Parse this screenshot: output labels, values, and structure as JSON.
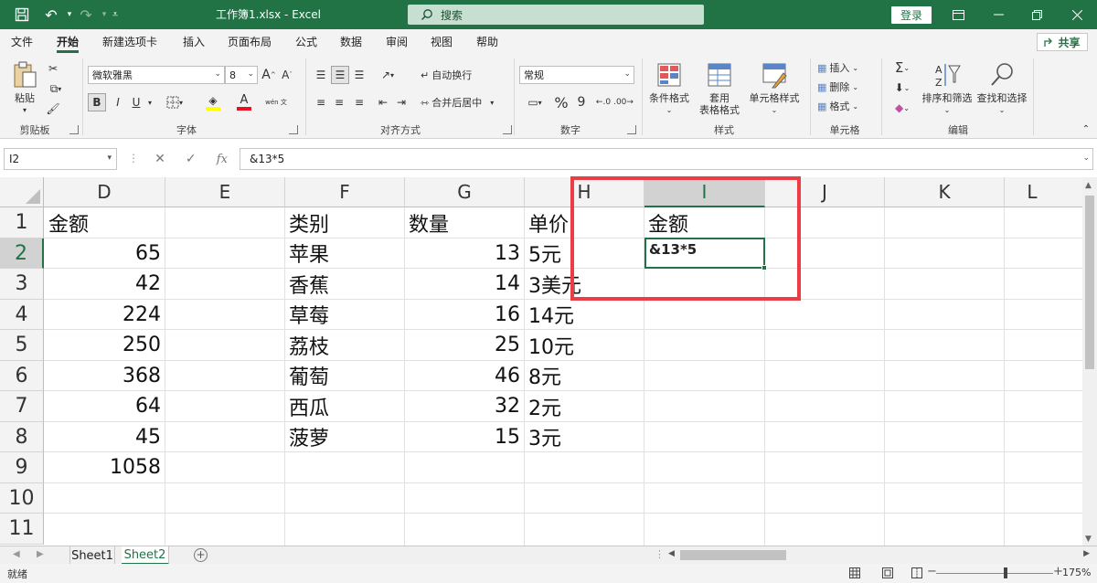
{
  "titlebar": {
    "title": "工作簿1.xlsx  -  Excel",
    "search_placeholder": "搜索",
    "login": "登录"
  },
  "tabs": [
    "文件",
    "开始",
    "新建选项卡",
    "插入",
    "页面布局",
    "公式",
    "数据",
    "审阅",
    "视图",
    "帮助"
  ],
  "active_tab": "开始",
  "share": "共享",
  "ribbon": {
    "clipboard": {
      "paste": "粘贴",
      "label": "剪贴板"
    },
    "font": {
      "name": "微软雅黑",
      "size": "8",
      "label": "字体",
      "bold": "B",
      "italic": "I",
      "underline": "U",
      "wen": "wén 文"
    },
    "align": {
      "wrap": "自动换行",
      "merge": "合并后居中",
      "label": "对齐方式"
    },
    "number": {
      "format": "常规",
      "percent": "%",
      "comma": "9",
      "label": "数字"
    },
    "styles": {
      "conditional": "条件格式",
      "table_1": "套用",
      "table_2": "表格格式",
      "cell_styles": "单元格样式",
      "label": "样式"
    },
    "cells": {
      "insert": "插入",
      "delete": "删除",
      "format": "格式",
      "label": "单元格"
    },
    "editing": {
      "sort": "排序和筛选",
      "find": "查找和选择",
      "label": "编辑"
    }
  },
  "formula_bar": {
    "name_box": "I2",
    "fx": "fx",
    "content": "&13*5"
  },
  "columns": [
    "D",
    "E",
    "F",
    "G",
    "H",
    "I",
    "J",
    "K",
    "L"
  ],
  "selected_column": "I",
  "rows": [
    "1",
    "2",
    "3",
    "4",
    "5",
    "6",
    "7",
    "8",
    "9",
    "10",
    "11"
  ],
  "selected_row": "2",
  "sheet": {
    "D": [
      "金额",
      "65",
      "42",
      "224",
      "250",
      "368",
      "64",
      "45",
      "1058"
    ],
    "F": [
      "类别",
      "苹果",
      "香蕉",
      "草莓",
      "荔枝",
      "葡萄",
      "西瓜",
      "菠萝"
    ],
    "G": [
      "数量",
      "13",
      "14",
      "16",
      "25",
      "46",
      "32",
      "15"
    ],
    "H": [
      "单价",
      "5元",
      "3美元",
      "14元",
      "10元",
      "8元",
      "2元",
      "3元"
    ],
    "I": [
      "金额",
      "&13*5"
    ]
  },
  "sheet_tabs": [
    "Sheet1",
    "Sheet2"
  ],
  "active_sheet": "Sheet2",
  "status": {
    "text": "就绪",
    "zoom": "175%"
  },
  "colors": {
    "brand": "#217346",
    "annotation": "#ec3c46"
  }
}
